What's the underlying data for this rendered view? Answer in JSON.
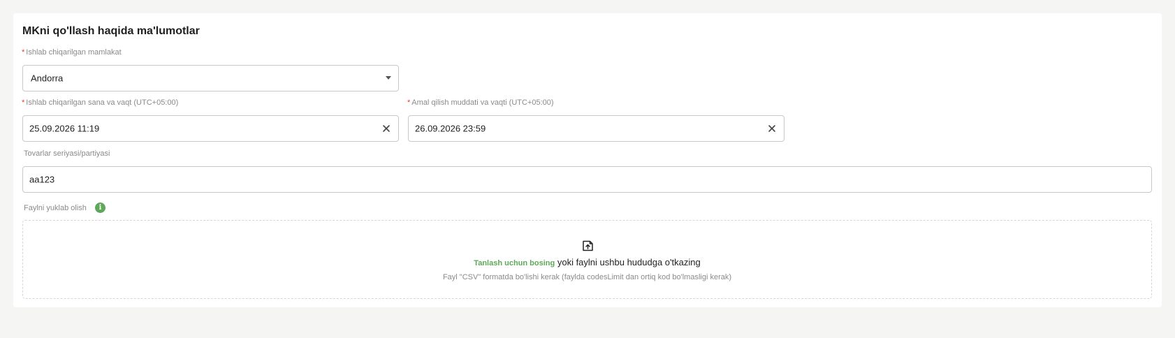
{
  "section": {
    "title": "MKni qo'llash haqida ma'lumotlar"
  },
  "country": {
    "label": "Ishlab chiqarilgan mamlakat",
    "required_mark": "*",
    "value": "Andorra"
  },
  "manufactured": {
    "label": "Ishlab chiqarilgan sana va vaqt (UTC+05:00)",
    "required_mark": "*",
    "value": "25.09.2026 11:19"
  },
  "expiry": {
    "label": "Amal qilish muddati va vaqti (UTC+05:00)",
    "required_mark": "*",
    "value": "26.09.2026 23:59"
  },
  "batch": {
    "label": "Tovarlar seriyasi/partiyasi",
    "value": "aa123"
  },
  "upload": {
    "label": "Faylni yuklab olish",
    "info_icon": "info-icon",
    "upload_icon": "upload-icon",
    "link_text": "Tanlash uchun bosing",
    "drop_text": "yoki faylni ushbu hududga o'tkazing",
    "hint": "Fayl \"CSV\" formatda bo'lishi kerak (faylda codesLimit dan ortiq kod bo'lmasligi kerak)"
  },
  "colors": {
    "accent": "#5fa85a",
    "required": "#e53935",
    "background": "#f5f5f3"
  }
}
